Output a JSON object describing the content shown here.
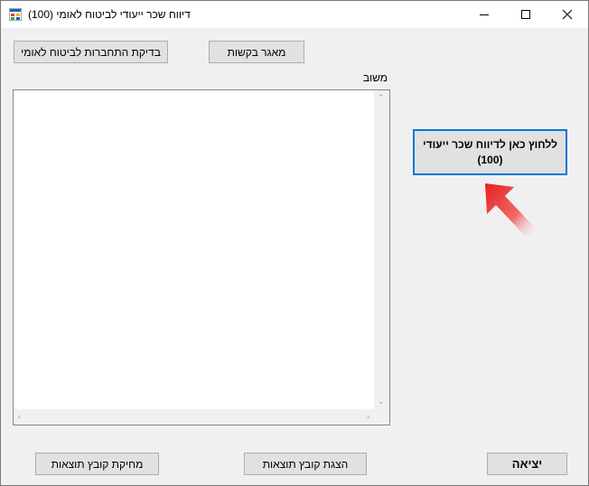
{
  "window": {
    "title": "דיווח שכר ייעודי לביטוח לאומי (100)",
    "icons": {
      "app": "app-icon",
      "minimize": "minimize-icon",
      "maximize": "maximize-icon",
      "close": "close-icon"
    }
  },
  "toolbar": {
    "nid_check_label": "בדיקת התחברות לביטוח לאומי",
    "contacts_label": "מאגר בקשות"
  },
  "feedback": {
    "label": "משוב",
    "value": ""
  },
  "report_button": {
    "label": "ללחוץ כאן לדיווח שכר ייעודי (100)"
  },
  "footer": {
    "delete_label": "מחיקת קובץ תוצאות",
    "show_label": "הצגת קובץ תוצאות",
    "exit_label": "יציאה"
  },
  "colors": {
    "accent": "#0078d7",
    "pointer": "#e81e1e",
    "window_bg": "#f0f0f0"
  }
}
